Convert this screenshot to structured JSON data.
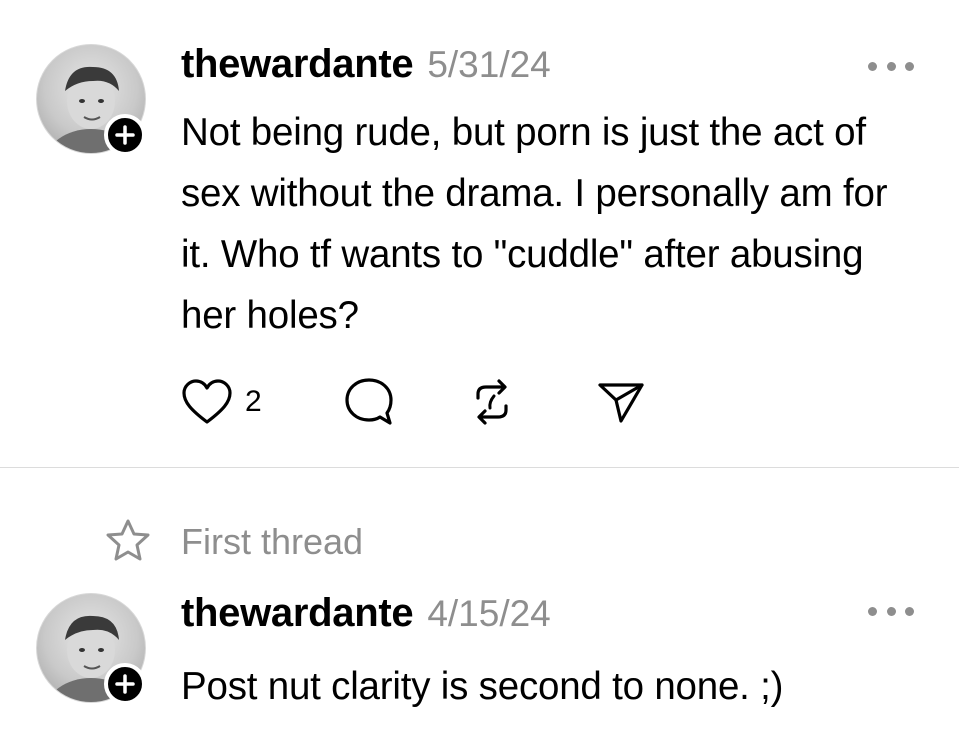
{
  "posts": [
    {
      "username": "thewardante",
      "date": "5/31/24",
      "text": "Not being rude, but porn is just the act of sex without the drama. I personally am for it. Who tf wants to \"cuddle\" after abusing her holes?",
      "likes": "2"
    },
    {
      "context_label": "First thread",
      "username": "thewardante",
      "date": "4/15/24",
      "text": "Post nut clarity is second to none. ;)"
    }
  ],
  "icons": {
    "avatar": "profile-photo",
    "follow": "plus-icon",
    "more": "ellipsis-icon",
    "like": "heart-icon",
    "comment": "comment-icon",
    "repost": "repost-icon",
    "share": "send-icon",
    "context": "star-icon"
  },
  "colors": {
    "text": "#000000",
    "secondary": "#8e8e8e",
    "divider": "#dcdcdc",
    "background": "#ffffff"
  }
}
